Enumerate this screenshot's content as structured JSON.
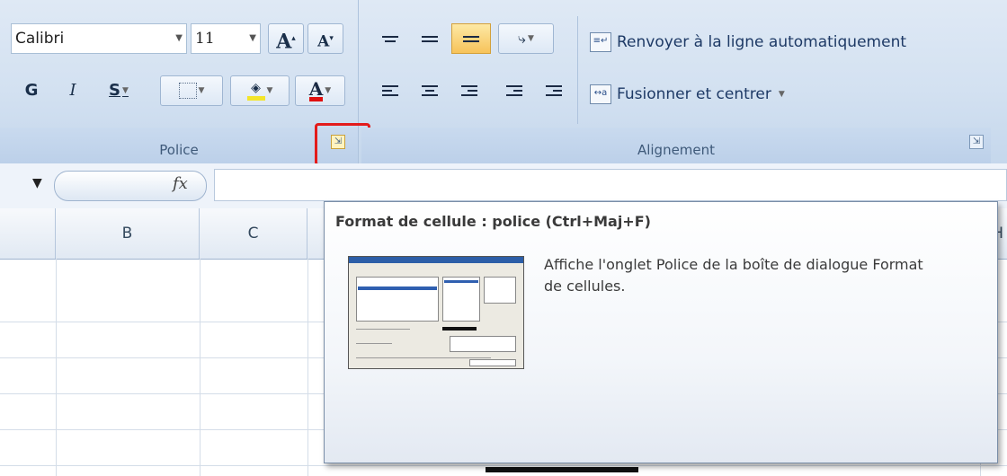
{
  "ribbon": {
    "font_group": {
      "font_name": "Calibri",
      "font_size": "11",
      "grow_font_label": "A",
      "shrink_font_label": "A",
      "bold_label": "G",
      "italic_label": "I",
      "underline_label": "S",
      "font_color_label": "A",
      "group_label": "Police"
    },
    "alignment_group": {
      "wrap_text_label": "Renvoyer à la ligne automatiquement",
      "merge_center_label": "Fusionner et centrer",
      "group_label": "Alignement"
    },
    "highlight_color": "#e31b1b",
    "fill_color": "#f3e52a",
    "font_color": "#e01010"
  },
  "formula_bar": {
    "fx_label": "fx"
  },
  "columns": [
    "B",
    "C",
    "H"
  ],
  "tooltip": {
    "title": "Format de cellule : police (Ctrl+Maj+F)",
    "body": "Affiche l'onglet Police de la boîte de dialogue Format de cellules."
  }
}
